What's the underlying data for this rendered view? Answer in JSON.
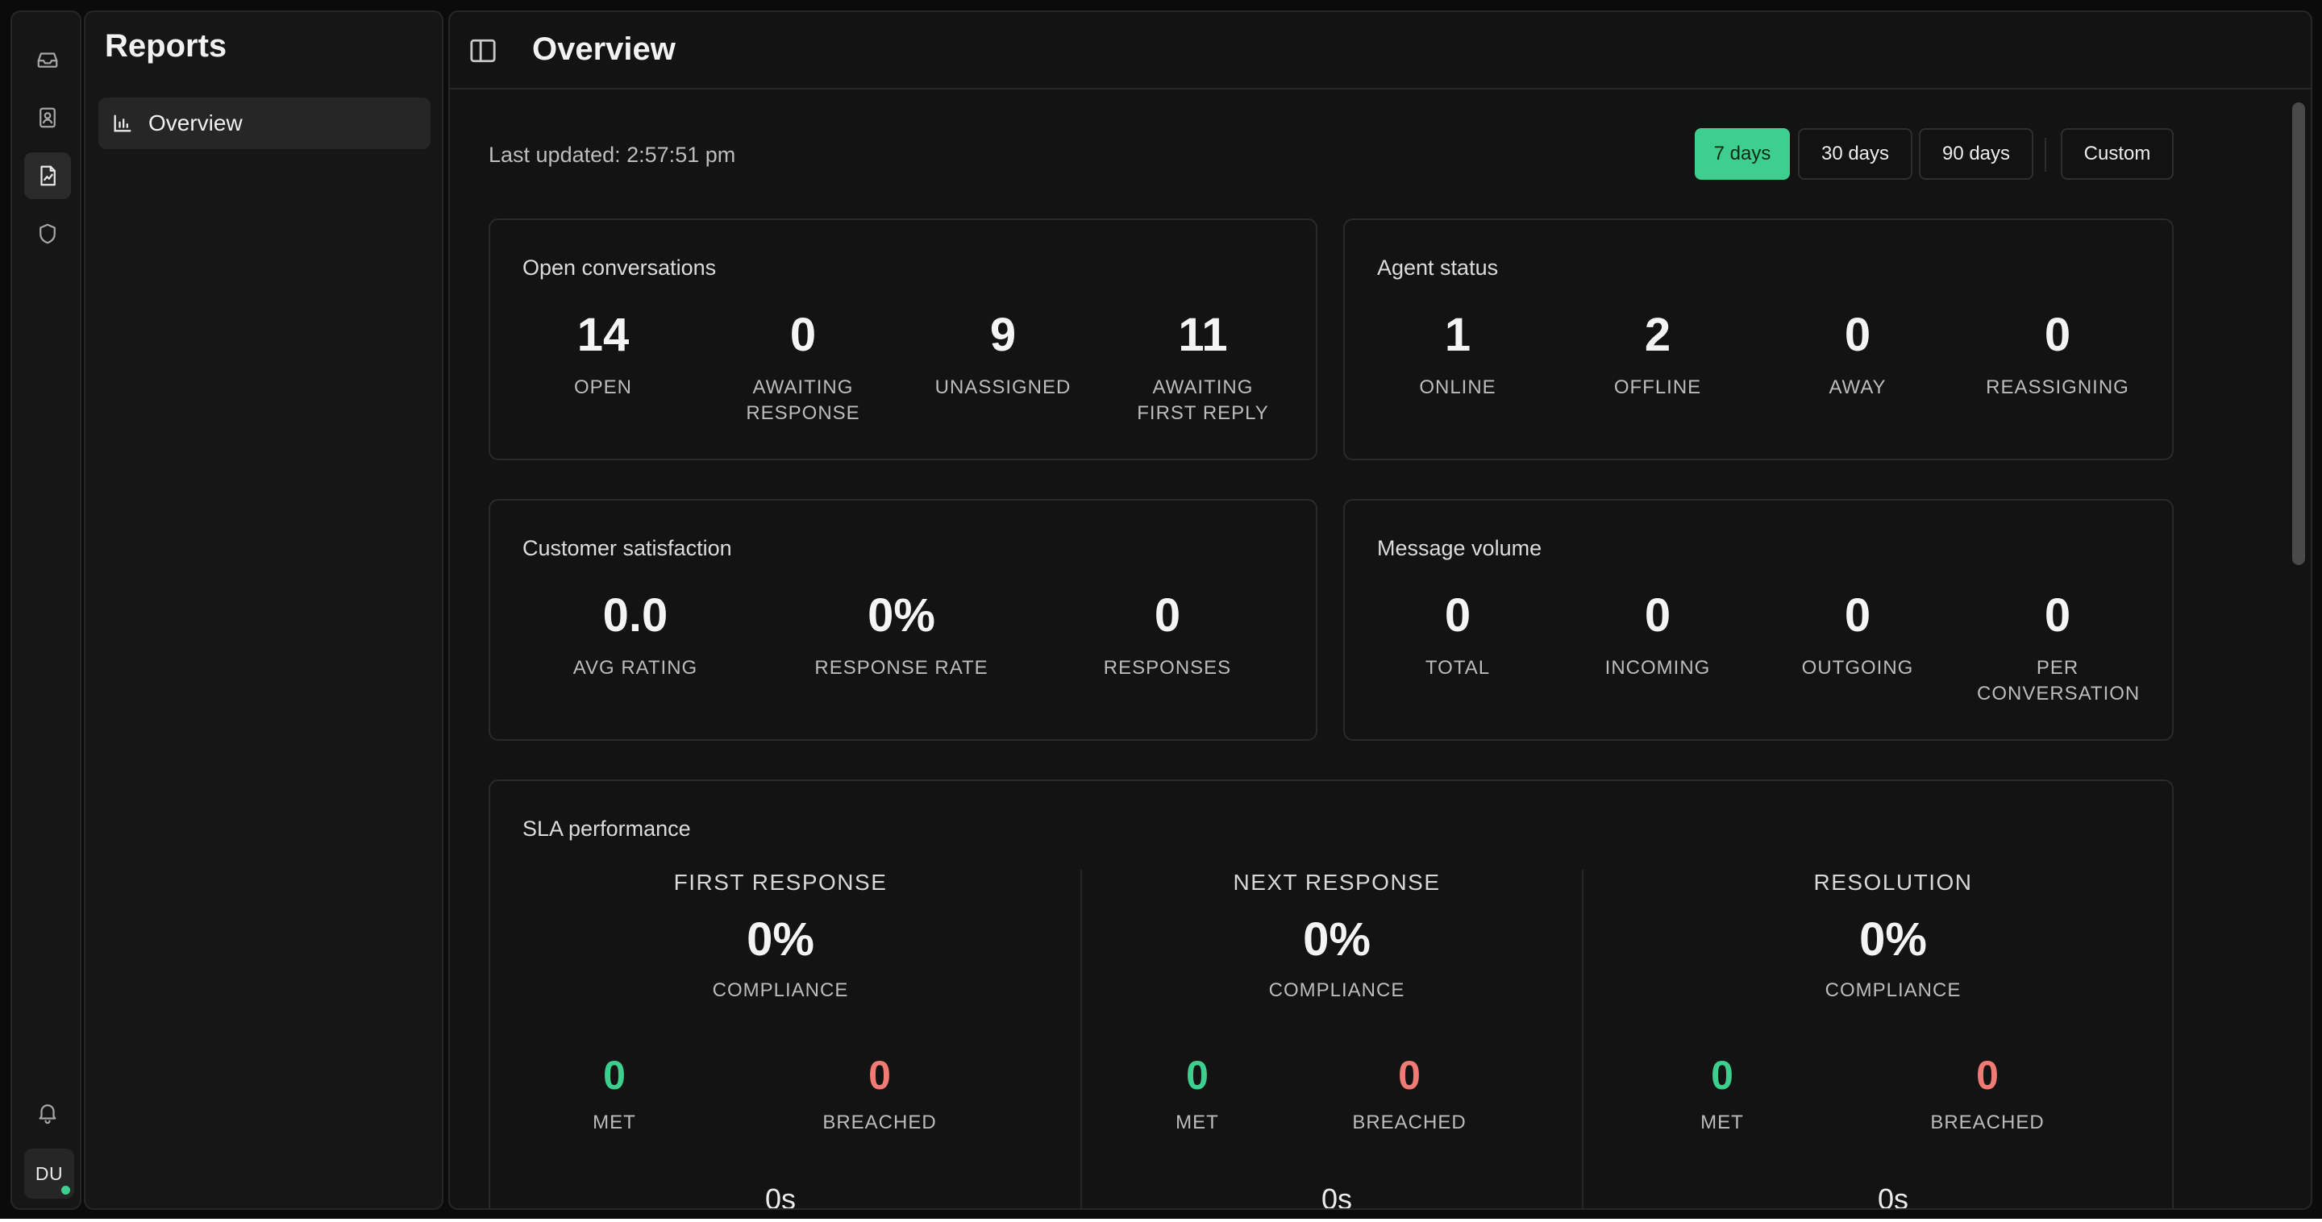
{
  "rail": {
    "items": [
      {
        "icon": "inbox-icon"
      },
      {
        "icon": "contacts-icon"
      },
      {
        "icon": "reports-icon",
        "active": true
      },
      {
        "icon": "shield-icon"
      }
    ],
    "bell_icon": "bell-icon",
    "avatar_initials": "DU",
    "avatar_status_color": "#3ecf8e"
  },
  "sidebar": {
    "title": "Reports",
    "items": [
      {
        "label": "Overview",
        "icon": "bar-chart-icon",
        "active": true
      }
    ]
  },
  "header": {
    "title": "Overview"
  },
  "toolbar": {
    "last_updated": "Last updated: 2:57:51 pm",
    "ranges": [
      "7 days",
      "30 days",
      "90 days"
    ],
    "active_range": "7 days",
    "custom_label": "Custom",
    "accent_color": "#3ecf8e"
  },
  "open_conversations": {
    "title": "Open conversations",
    "stats": [
      {
        "value": "14",
        "label": "OPEN"
      },
      {
        "value": "0",
        "label": "AWAITING RESPONSE"
      },
      {
        "value": "9",
        "label": "UNASSIGNED"
      },
      {
        "value": "11",
        "label": "AWAITING FIRST REPLY"
      }
    ]
  },
  "agent_status": {
    "title": "Agent status",
    "stats": [
      {
        "value": "1",
        "label": "ONLINE"
      },
      {
        "value": "2",
        "label": "OFFLINE"
      },
      {
        "value": "0",
        "label": "AWAY"
      },
      {
        "value": "0",
        "label": "REASSIGNING"
      }
    ]
  },
  "customer_satisfaction": {
    "title": "Customer satisfaction",
    "stats": [
      {
        "value": "0.0",
        "label": "AVG RATING"
      },
      {
        "value": "0%",
        "label": "RESPONSE RATE"
      },
      {
        "value": "0",
        "label": "RESPONSES"
      }
    ]
  },
  "message_volume": {
    "title": "Message volume",
    "stats": [
      {
        "value": "0",
        "label": "TOTAL"
      },
      {
        "value": "0",
        "label": "INCOMING"
      },
      {
        "value": "0",
        "label": "OUTGOING"
      },
      {
        "value": "0",
        "label": "PER CONVERSATION"
      }
    ]
  },
  "sla": {
    "title": "SLA performance",
    "columns": [
      {
        "heading": "FIRST RESPONSE",
        "compliance": "0%",
        "compliance_label": "COMPLIANCE",
        "met": "0",
        "met_label": "MET",
        "breached": "0",
        "breached_label": "BREACHED",
        "time": "0s"
      },
      {
        "heading": "NEXT RESPONSE",
        "compliance": "0%",
        "compliance_label": "COMPLIANCE",
        "met": "0",
        "met_label": "MET",
        "breached": "0",
        "breached_label": "BREACHED",
        "time": "0s"
      },
      {
        "heading": "RESOLUTION",
        "compliance": "0%",
        "compliance_label": "COMPLIANCE",
        "met": "0",
        "met_label": "MET",
        "breached": "0",
        "breached_label": "BREACHED",
        "time": "0s"
      }
    ],
    "met_color": "#3ecf8e",
    "breached_color": "#f07b74"
  }
}
